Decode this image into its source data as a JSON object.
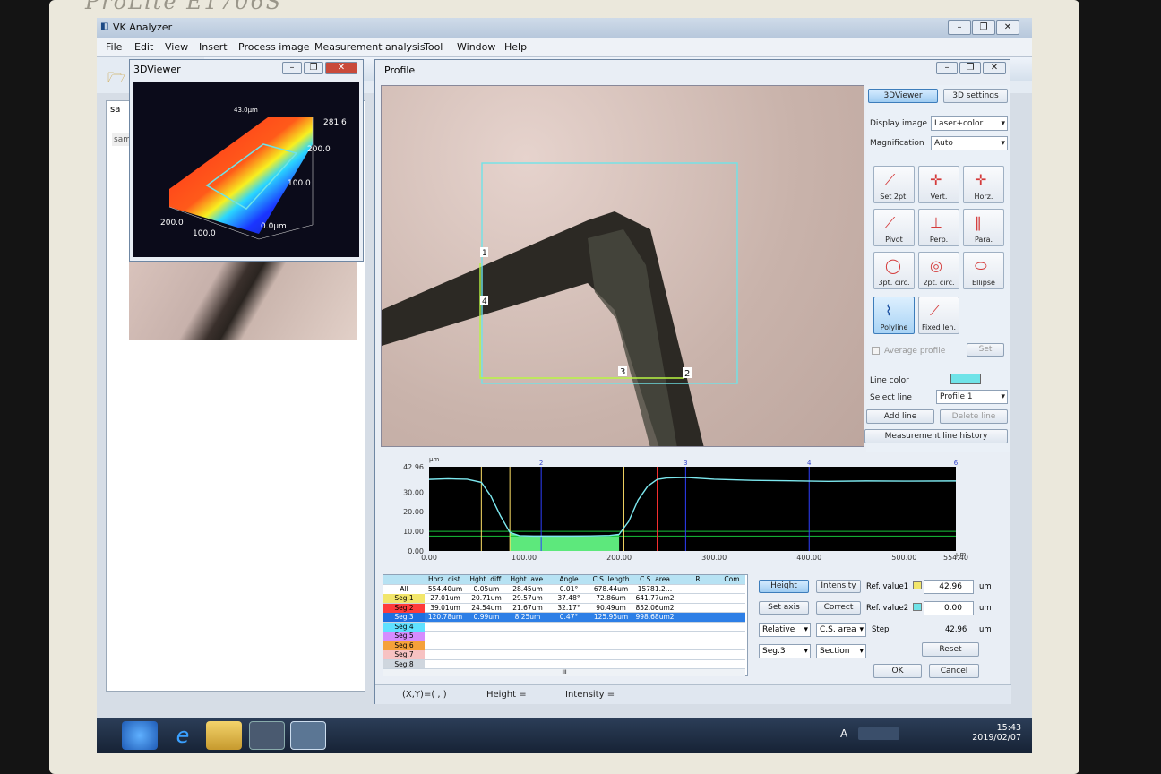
{
  "monitor": {
    "brand": "ProLite E1706S"
  },
  "app": {
    "title": "VK Analyzer"
  },
  "menu": [
    "File",
    "Edit",
    "View",
    "Insert",
    "Process image",
    "Measurement analysis",
    "Tool",
    "Window",
    "Help"
  ],
  "left_pane": {
    "partial_labels": [
      "sa",
      "sam"
    ]
  },
  "viewer3d": {
    "title": "3DViewer",
    "labels": {
      "top_unit": "43.0µm",
      "z_max": "281.6",
      "z_200": "200.0",
      "z_100": "100.0",
      "x_200": "200.0",
      "x_100": "100.0",
      "zero": "0.0µm"
    }
  },
  "profile": {
    "title": "Profile",
    "marker_labels": [
      "1",
      "2",
      "3",
      "4"
    ],
    "panel": {
      "btn_3dviewer": "3DViewer",
      "btn_3dsettings": "3D settings",
      "display_image_label": "Display image",
      "display_image_value": "Laser+color",
      "magnification_label": "Magnification",
      "magnification_value": "Auto",
      "tools": [
        "Set 2pt.",
        "Vert.",
        "Horz.",
        "Pivot",
        "Perp.",
        "Para.",
        "3pt. circ.",
        "2pt. circ.",
        "Ellipse",
        "Polyline",
        "Fixed len."
      ],
      "average_profile": "Average profile",
      "set": "Set",
      "line_color_label": "Line color",
      "line_color": "#6fe3e8",
      "select_line_label": "Select line",
      "select_line_value": "Profile 1",
      "add_line": "Add line",
      "delete_line": "Delete line",
      "history": "Measurement line history"
    },
    "graph": {
      "y_unit": "µm",
      "x_unit": "µm",
      "y_ticks": [
        "42.96",
        "30.00",
        "20.00",
        "10.00",
        "0.00"
      ],
      "x_ticks": [
        "0.00",
        "100.00",
        "200.00",
        "300.00",
        "400.00",
        "500.00",
        "554.40"
      ],
      "top_markers": [
        "2",
        "3",
        "4",
        "6"
      ]
    },
    "table": {
      "headers": [
        "",
        "Horz. dist.",
        "Hght. diff.",
        "Hght. ave.",
        "Angle",
        "C.S. length",
        "C.S. area",
        "R",
        "Com"
      ],
      "rows": [
        [
          "All",
          "554.40um",
          "0.05um",
          "28.45um",
          "0.01°",
          "678.44um",
          "15781.2…",
          ""
        ],
        [
          "Seg.1",
          "27.01um",
          "20.71um",
          "29.57um",
          "37.48°",
          "72.86um",
          "641.77um2",
          ""
        ],
        [
          "Seg.2",
          "39.01um",
          "24.54um",
          "21.67um",
          "32.17°",
          "90.49um",
          "852.06um2",
          ""
        ],
        [
          "Seg.3",
          "120.78um",
          "0.99um",
          "8.25um",
          "0.47°",
          "125.95um",
          "998.68um2",
          ""
        ],
        [
          "Seg.4",
          "",
          "",
          "",
          "",
          "",
          "",
          ""
        ],
        [
          "Seg.5",
          "",
          "",
          "",
          "",
          "",
          "",
          ""
        ],
        [
          "Seg.6",
          "",
          "",
          "",
          "",
          "",
          "",
          ""
        ],
        [
          "Seg.7",
          "",
          "",
          "",
          "",
          "",
          "",
          ""
        ],
        [
          "Seg.8",
          "",
          "",
          "",
          "",
          "",
          "",
          ""
        ]
      ],
      "scroll_mark": "III"
    },
    "controls": {
      "height": "Height",
      "intensity": "Intensity",
      "ref1_label": "Ref. value1",
      "ref1_value": "42.96",
      "ref2_label": "Ref. value2",
      "ref2_value": "0.00",
      "unit": "um",
      "set_axis": "Set axis",
      "correct": "Correct",
      "relative": "Relative",
      "cs_area": "C.S. area",
      "step_label": "Step",
      "step_value": "42.96",
      "seg": "Seg.3",
      "section": "Section",
      "reset": "Reset",
      "ok": "OK",
      "cancel": "Cancel"
    },
    "status": {
      "xy": "(X,Y)=( , )",
      "height": "Height =",
      "intensity": "Intensity ="
    }
  },
  "taskbar": {
    "time": "15:43",
    "date": "2019/02/07",
    "ime": "A"
  },
  "chart_data": {
    "type": "line",
    "x": [
      0,
      20,
      40,
      55,
      65,
      75,
      85,
      95,
      110,
      130,
      150,
      170,
      190,
      200,
      210,
      220,
      230,
      240,
      250,
      270,
      300,
      340,
      380,
      420,
      460,
      500,
      554.4
    ],
    "values": [
      36.5,
      36.8,
      36.6,
      35,
      28,
      18,
      9.5,
      7.8,
      7.6,
      7.6,
      7.6,
      7.7,
      7.9,
      8.5,
      15,
      26,
      33,
      36.5,
      37.2,
      37.5,
      36.6,
      36.0,
      35.8,
      35.5,
      35.7,
      35.6,
      35.7
    ],
    "series": [
      {
        "name": "",
        "values": []
      }
    ],
    "ylim": [
      0,
      42.96
    ],
    "xlim": [
      0,
      554.4
    ],
    "vlines": [
      {
        "x": 55,
        "color": "#ffe066"
      },
      {
        "x": 85,
        "color": "#ffe066"
      },
      {
        "x": 118,
        "color": "#2f3fff"
      },
      {
        "x": 205,
        "color": "#ffe066"
      },
      {
        "x": 240,
        "color": "#ff3030"
      },
      {
        "x": 270,
        "color": "#2f3fff"
      },
      {
        "x": 400,
        "color": "#2f3fff"
      }
    ],
    "hlines": [
      {
        "y": 10.0,
        "color": "#18c23a"
      },
      {
        "y": 7.6,
        "color": "#18c23a"
      }
    ],
    "fill_range": [
      85,
      205
    ],
    "line_color": "#7de8ef",
    "fill_color": "#5de87c",
    "background": "#000000"
  }
}
